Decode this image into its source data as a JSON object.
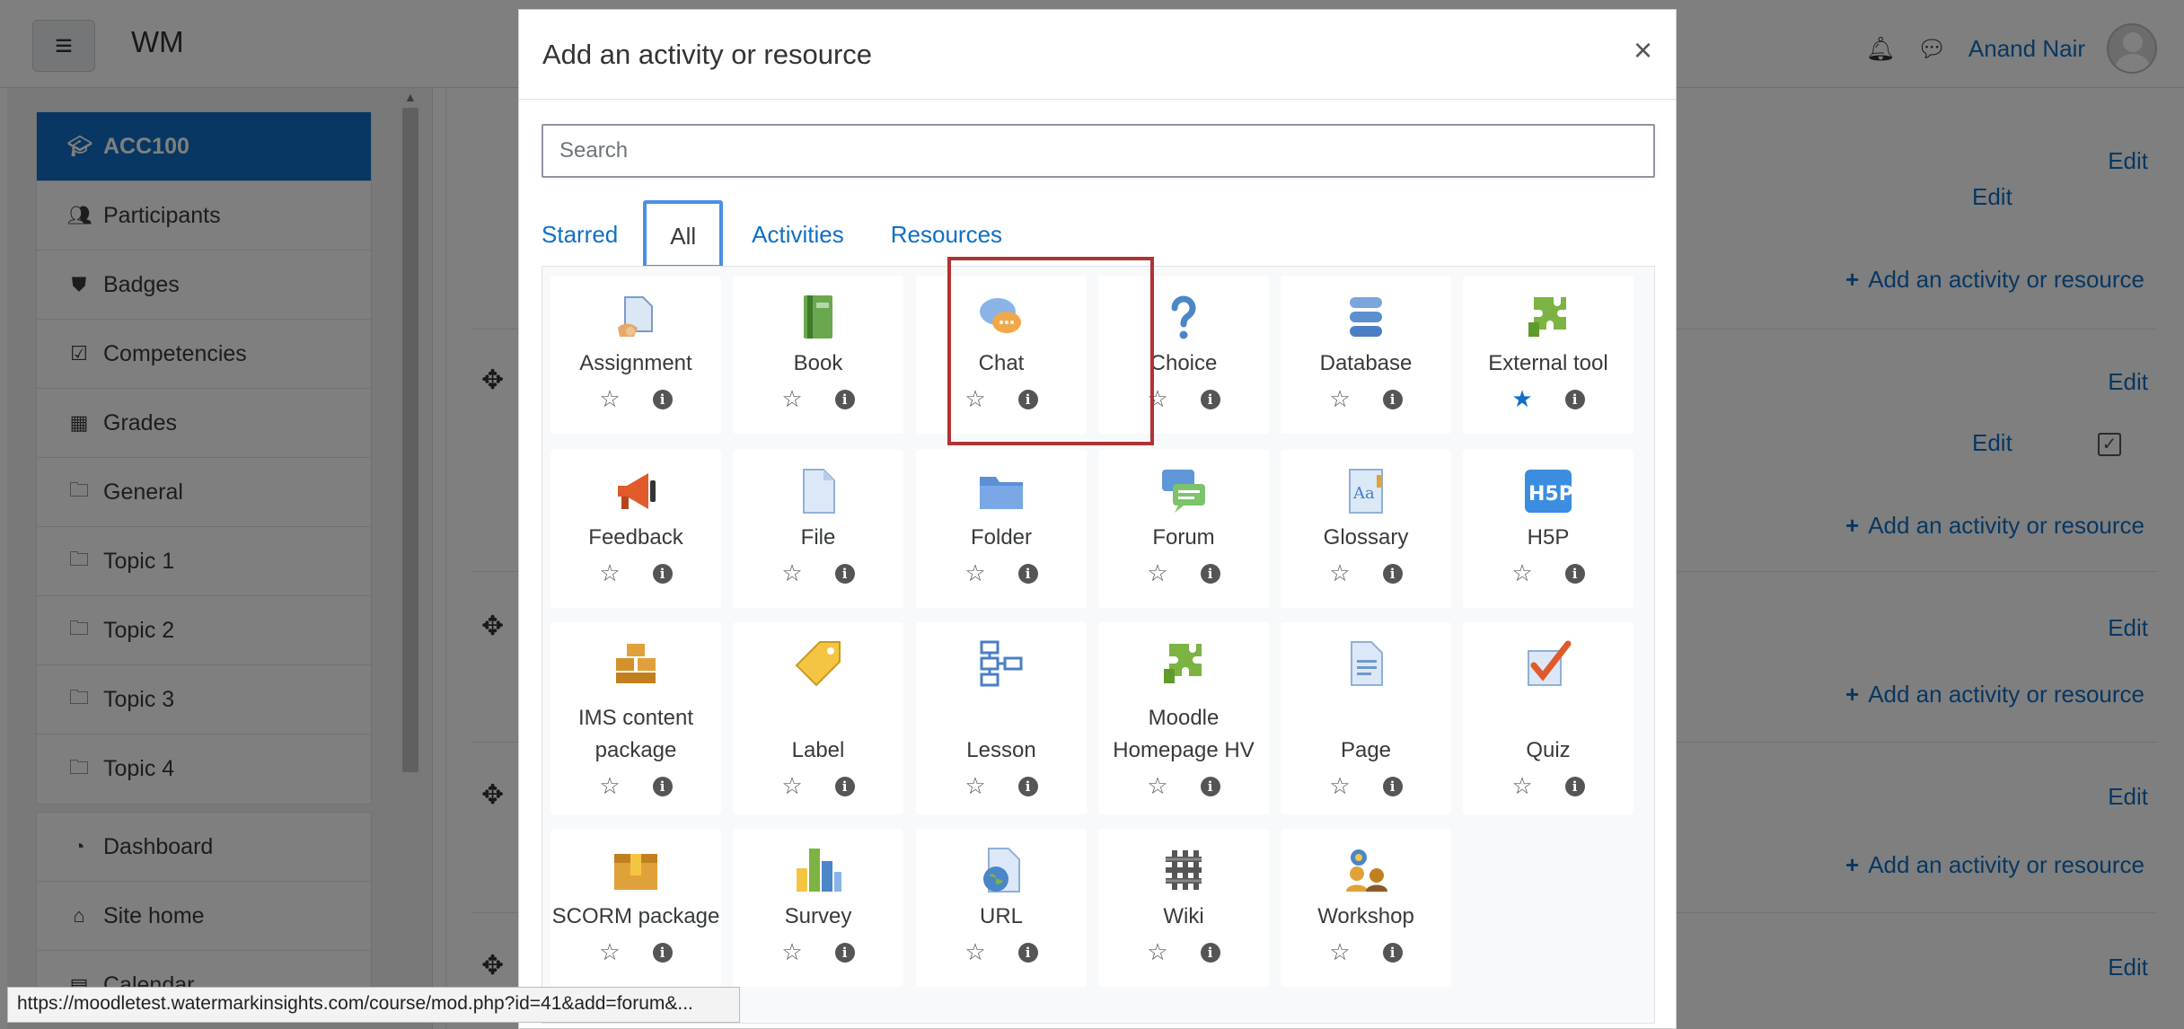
{
  "header": {
    "brand": "WM",
    "user_name": "Anand Nair"
  },
  "sidebar": {
    "course": "ACC100",
    "items": [
      "Participants",
      "Badges",
      "Competencies",
      "Grades",
      "General",
      "Topic 1",
      "Topic 2",
      "Topic 3",
      "Topic 4"
    ],
    "items2": [
      "Dashboard",
      "Site home",
      "Calendar"
    ]
  },
  "content": {
    "edit_label": "Edit",
    "add_label": "Add an activity or resource"
  },
  "status_url": "https://moodletest.watermarkinsights.com/course/mod.php?id=41&add=forum&...",
  "modal": {
    "title": "Add an activity or resource",
    "close": "×",
    "search_placeholder": "Search",
    "tabs": [
      "Starred",
      "All",
      "Activities",
      "Resources"
    ],
    "active_tab": "All",
    "items": [
      {
        "name": "Assignment",
        "icon": "assignment-icon",
        "starred": false
      },
      {
        "name": "Book",
        "icon": "book-icon",
        "starred": false
      },
      {
        "name": "Chat",
        "icon": "chat-icon",
        "starred": false
      },
      {
        "name": "Choice",
        "icon": "choice-icon",
        "starred": false
      },
      {
        "name": "Database",
        "icon": "database-icon",
        "starred": false
      },
      {
        "name": "External tool",
        "icon": "puzzle-icon",
        "starred": true
      },
      {
        "name": "Feedback",
        "icon": "megaphone-icon",
        "starred": false
      },
      {
        "name": "File",
        "icon": "file-icon",
        "starred": false
      },
      {
        "name": "Folder",
        "icon": "folder-icon",
        "starred": false
      },
      {
        "name": "Forum",
        "icon": "forum-icon",
        "starred": false
      },
      {
        "name": "Glossary",
        "icon": "glossary-icon",
        "starred": false
      },
      {
        "name": "H5P",
        "icon": "h5p-icon",
        "starred": false
      },
      {
        "name": "IMS content package",
        "icon": "ims-package-icon",
        "starred": false
      },
      {
        "name": "Label",
        "icon": "label-tag-icon",
        "starred": false
      },
      {
        "name": "Lesson",
        "icon": "lesson-icon",
        "starred": false
      },
      {
        "name": "Moodle Homepage HV",
        "icon": "puzzle-icon",
        "starred": false
      },
      {
        "name": "Page",
        "icon": "page-icon",
        "starred": false
      },
      {
        "name": "Quiz",
        "icon": "quiz-icon",
        "starred": false
      },
      {
        "name": "SCORM package",
        "icon": "scorm-icon",
        "starred": false
      },
      {
        "name": "Survey",
        "icon": "survey-chart-icon",
        "starred": false
      },
      {
        "name": "URL",
        "icon": "url-globe-icon",
        "starred": false
      },
      {
        "name": "Wiki",
        "icon": "wiki-icon",
        "starred": false
      },
      {
        "name": "Workshop",
        "icon": "workshop-icon",
        "starred": false
      }
    ],
    "h5p_text": "H5P",
    "glossary_text": "Aa"
  },
  "colors": {
    "link": "#0f6fc5",
    "highlight": "#b03333",
    "tab_focus": "#4a90e2"
  }
}
